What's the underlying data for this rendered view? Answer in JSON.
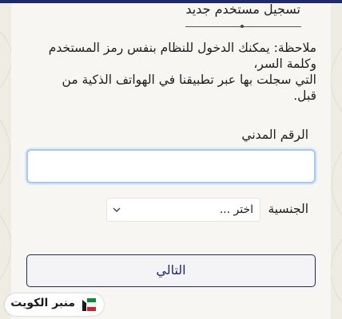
{
  "header": {
    "title": "تسجيل مستخدم جديد"
  },
  "note": {
    "lines": [
      "ملاحظة: يمكنك الدخول للنظام بنفس رمز المستخدم",
      "وكلمة السر،",
      "التي سجلت بها عبر تطبيقنا في الهواتف الذكية من",
      "قبل."
    ]
  },
  "form": {
    "civil_id": {
      "label": "الرقم المدني",
      "value": "",
      "placeholder": ""
    },
    "nationality": {
      "label": "الجنسية",
      "selected": "اختر ..."
    },
    "next_label": "التالي"
  },
  "watermark": {
    "text": "منبر الكويت",
    "icon": "kuwait-flag-logo-icon"
  },
  "colors": {
    "accent": "#1f2a6b",
    "input_focus": "#a8c8ee",
    "background": "#efece4",
    "flag_green": "#0a8a3a",
    "flag_red": "#d21f2b"
  }
}
